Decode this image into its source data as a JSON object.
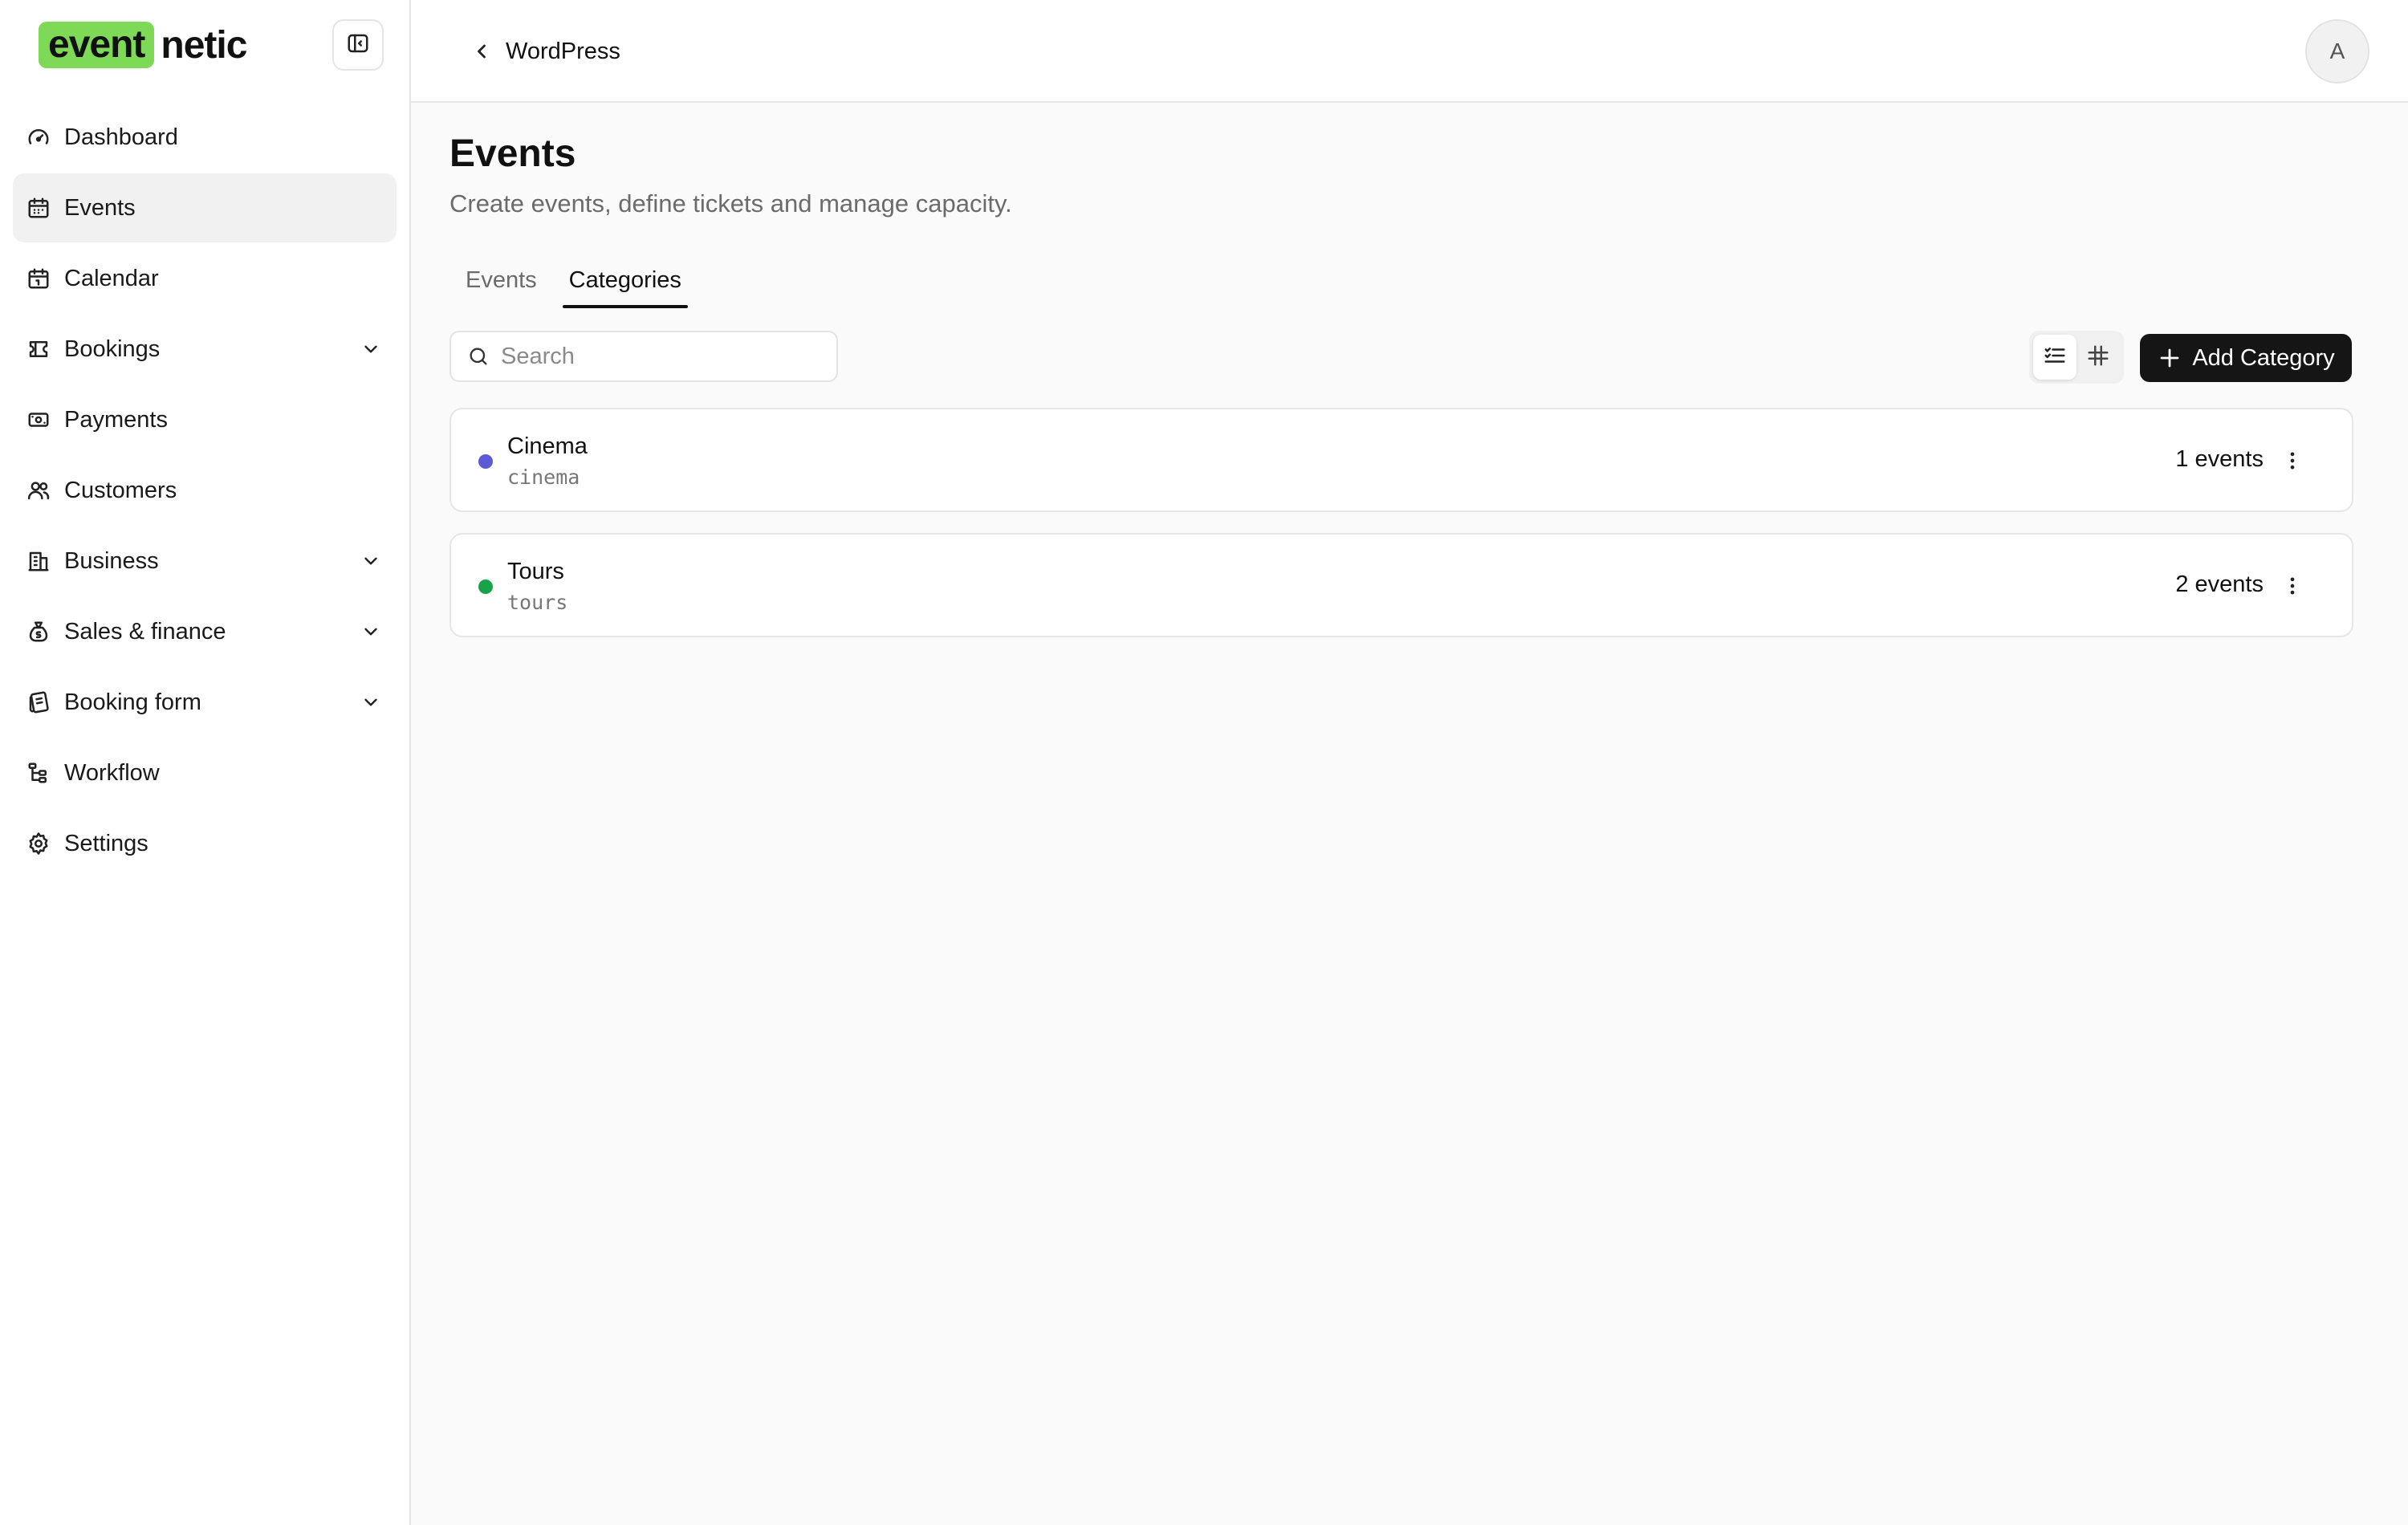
{
  "brand": {
    "logo_highlight": "event",
    "logo_rest": "netic",
    "accent": "#7ed957"
  },
  "sidebar": {
    "items": [
      {
        "label": "Dashboard",
        "icon": "gauge-icon",
        "expandable": false
      },
      {
        "label": "Events",
        "icon": "calendar-icon",
        "expandable": false,
        "active": true
      },
      {
        "label": "Calendar",
        "icon": "calendar-grid-icon",
        "expandable": false
      },
      {
        "label": "Bookings",
        "icon": "ticket-icon",
        "expandable": true
      },
      {
        "label": "Payments",
        "icon": "banknote-icon",
        "expandable": false
      },
      {
        "label": "Customers",
        "icon": "users-icon",
        "expandable": false
      },
      {
        "label": "Business",
        "icon": "building-icon",
        "expandable": true
      },
      {
        "label": "Sales & finance",
        "icon": "money-bag-icon",
        "expandable": true
      },
      {
        "label": "Booking form",
        "icon": "form-icon",
        "expandable": true
      },
      {
        "label": "Workflow",
        "icon": "workflow-icon",
        "expandable": false
      },
      {
        "label": "Settings",
        "icon": "gear-icon",
        "expandable": false
      }
    ]
  },
  "header": {
    "back_label": "WordPress",
    "avatar_initial": "A"
  },
  "page": {
    "title": "Events",
    "subtitle": "Create events, define tickets and manage capacity.",
    "tabs": [
      {
        "label": "Events",
        "active": false
      },
      {
        "label": "Categories",
        "active": true
      }
    ]
  },
  "toolbar": {
    "search_placeholder": "Search",
    "add_label": "Add Category",
    "view_modes": [
      "list-view-icon",
      "grid-view-icon"
    ]
  },
  "categories": [
    {
      "name": "Cinema",
      "slug": "cinema",
      "count": "1 events",
      "color": "#5b5bd6"
    },
    {
      "name": "Tours",
      "slug": "tours",
      "count": "2 events",
      "color": "#16a34a"
    }
  ]
}
